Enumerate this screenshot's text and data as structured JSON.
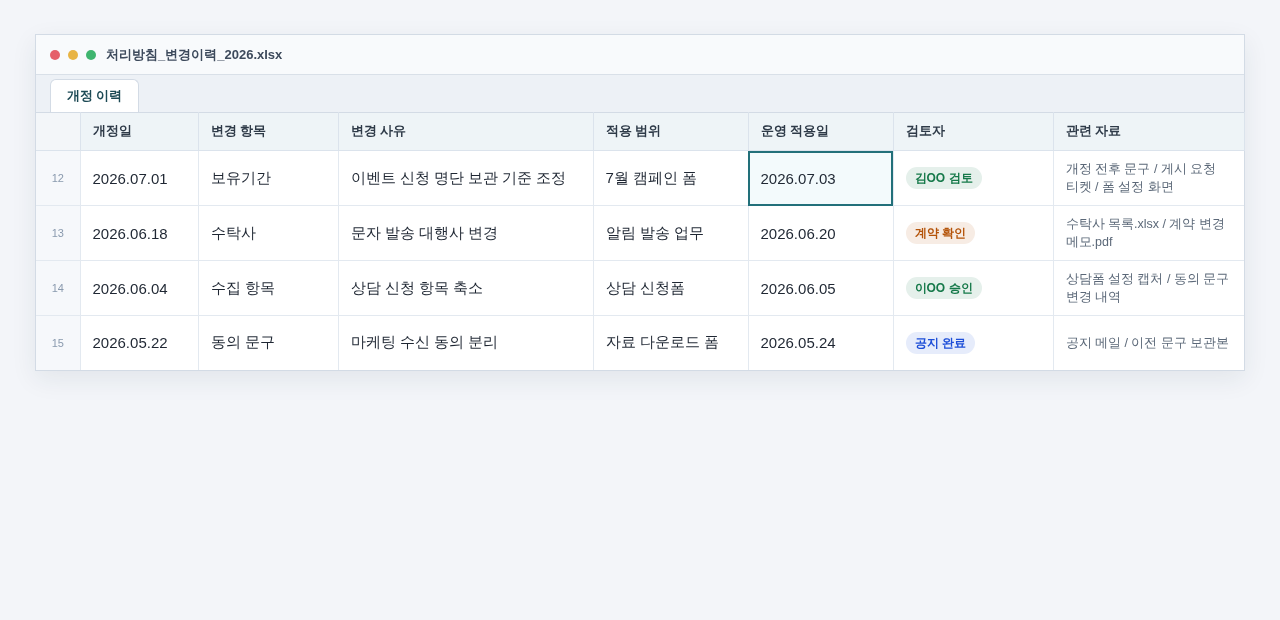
{
  "window": {
    "title": "처리방침_변경이력_2026.xlsx"
  },
  "tabs": [
    {
      "label": "개정 이력",
      "selected": true
    }
  ],
  "table": {
    "columns": [
      "개정일",
      "변경 항목",
      "변경 사유",
      "적용 범위",
      "운영 적용일",
      "검토자",
      "관련 자료"
    ],
    "rows": [
      {
        "number": "12",
        "cells": [
          {
            "text": "2026.07.01",
            "selected": false
          },
          {
            "text": "보유기간",
            "selected": false
          },
          {
            "text": "이벤트 신청 명단 보관 기준 조정",
            "selected": false
          },
          {
            "text": "7월 캠페인 폼",
            "selected": false
          },
          {
            "text": "2026.07.03",
            "selected": true
          }
        ],
        "reviewer": {
          "text": "김OO 검토",
          "color": "#16794a"
        },
        "materials": "개정 전후 문구 / 게시 요청 티켓 / 폼 설정 화면"
      },
      {
        "number": "13",
        "cells": [
          {
            "text": "2026.06.18",
            "selected": false
          },
          {
            "text": "수탁사",
            "selected": false
          },
          {
            "text": "문자 발송 대행사 변경",
            "selected": false
          },
          {
            "text": "알림 발송 업무",
            "selected": false
          },
          {
            "text": "2026.06.20",
            "selected": false
          }
        ],
        "reviewer": {
          "text": "계약 확인",
          "color": "#b45309"
        },
        "materials": "수탁사 목록.xlsx / 계약 변경 메모.pdf"
      },
      {
        "number": "14",
        "cells": [
          {
            "text": "2026.06.04",
            "selected": false
          },
          {
            "text": "수집 항목",
            "selected": false
          },
          {
            "text": "상담 신청 항목 축소",
            "selected": false
          },
          {
            "text": "상담 신청폼",
            "selected": false
          },
          {
            "text": "2026.06.05",
            "selected": false
          }
        ],
        "reviewer": {
          "text": "이OO 승인",
          "color": "#16794a"
        },
        "materials": "상담폼 설정 캡처 / 동의 문구 변경 내역"
      },
      {
        "number": "15",
        "cells": [
          {
            "text": "2026.05.22",
            "selected": false
          },
          {
            "text": "동의 문구",
            "selected": false
          },
          {
            "text": "마케팅 수신 동의 분리",
            "selected": false
          },
          {
            "text": "자료 다운로드 폼",
            "selected": false
          },
          {
            "text": "2026.05.24",
            "selected": false
          }
        ],
        "reviewer": {
          "text": "공지 완료",
          "color": "#1d4ed8"
        },
        "materials": "공지 메일 / 이전 문구 보관본"
      }
    ]
  }
}
